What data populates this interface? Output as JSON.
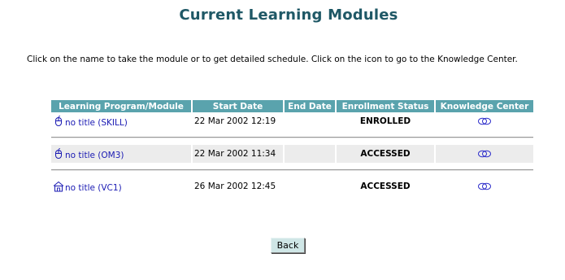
{
  "page": {
    "title": "Current Learning Modules",
    "instructions": "Click on the name to take the module or to get detailed schedule. Click on the icon to go to the Knowledge Center."
  },
  "table": {
    "columns": [
      "Learning Program/Module",
      "Start Date",
      "End Date",
      "Enrollment Status",
      "Knowledge Center"
    ],
    "rows": [
      {
        "icon": "mouse-icon",
        "name": "no title (SKILL)",
        "start_date": "22 Mar 2002 12:19",
        "end_date": "",
        "status": "ENROLLED",
        "kc_icon": "knowledge-center-icon"
      },
      {
        "icon": "mouse-icon",
        "name": "no title (OM3)",
        "start_date": "22 Mar 2002 11:34",
        "end_date": "",
        "status": "ACCESSED",
        "kc_icon": "knowledge-center-icon"
      },
      {
        "icon": "classroom-icon",
        "name": "no title (VC1)",
        "start_date": "26 Mar 2002 12:45",
        "end_date": "",
        "status": "ACCESSED",
        "kc_icon": "knowledge-center-icon"
      }
    ]
  },
  "buttons": {
    "back_label": "Back"
  },
  "colors": {
    "title": "#1f5866",
    "header_bg": "#5aa3ad",
    "link": "#1a1ab3",
    "alt_row": "#ececec",
    "button_bg": "#cfe6e6"
  }
}
